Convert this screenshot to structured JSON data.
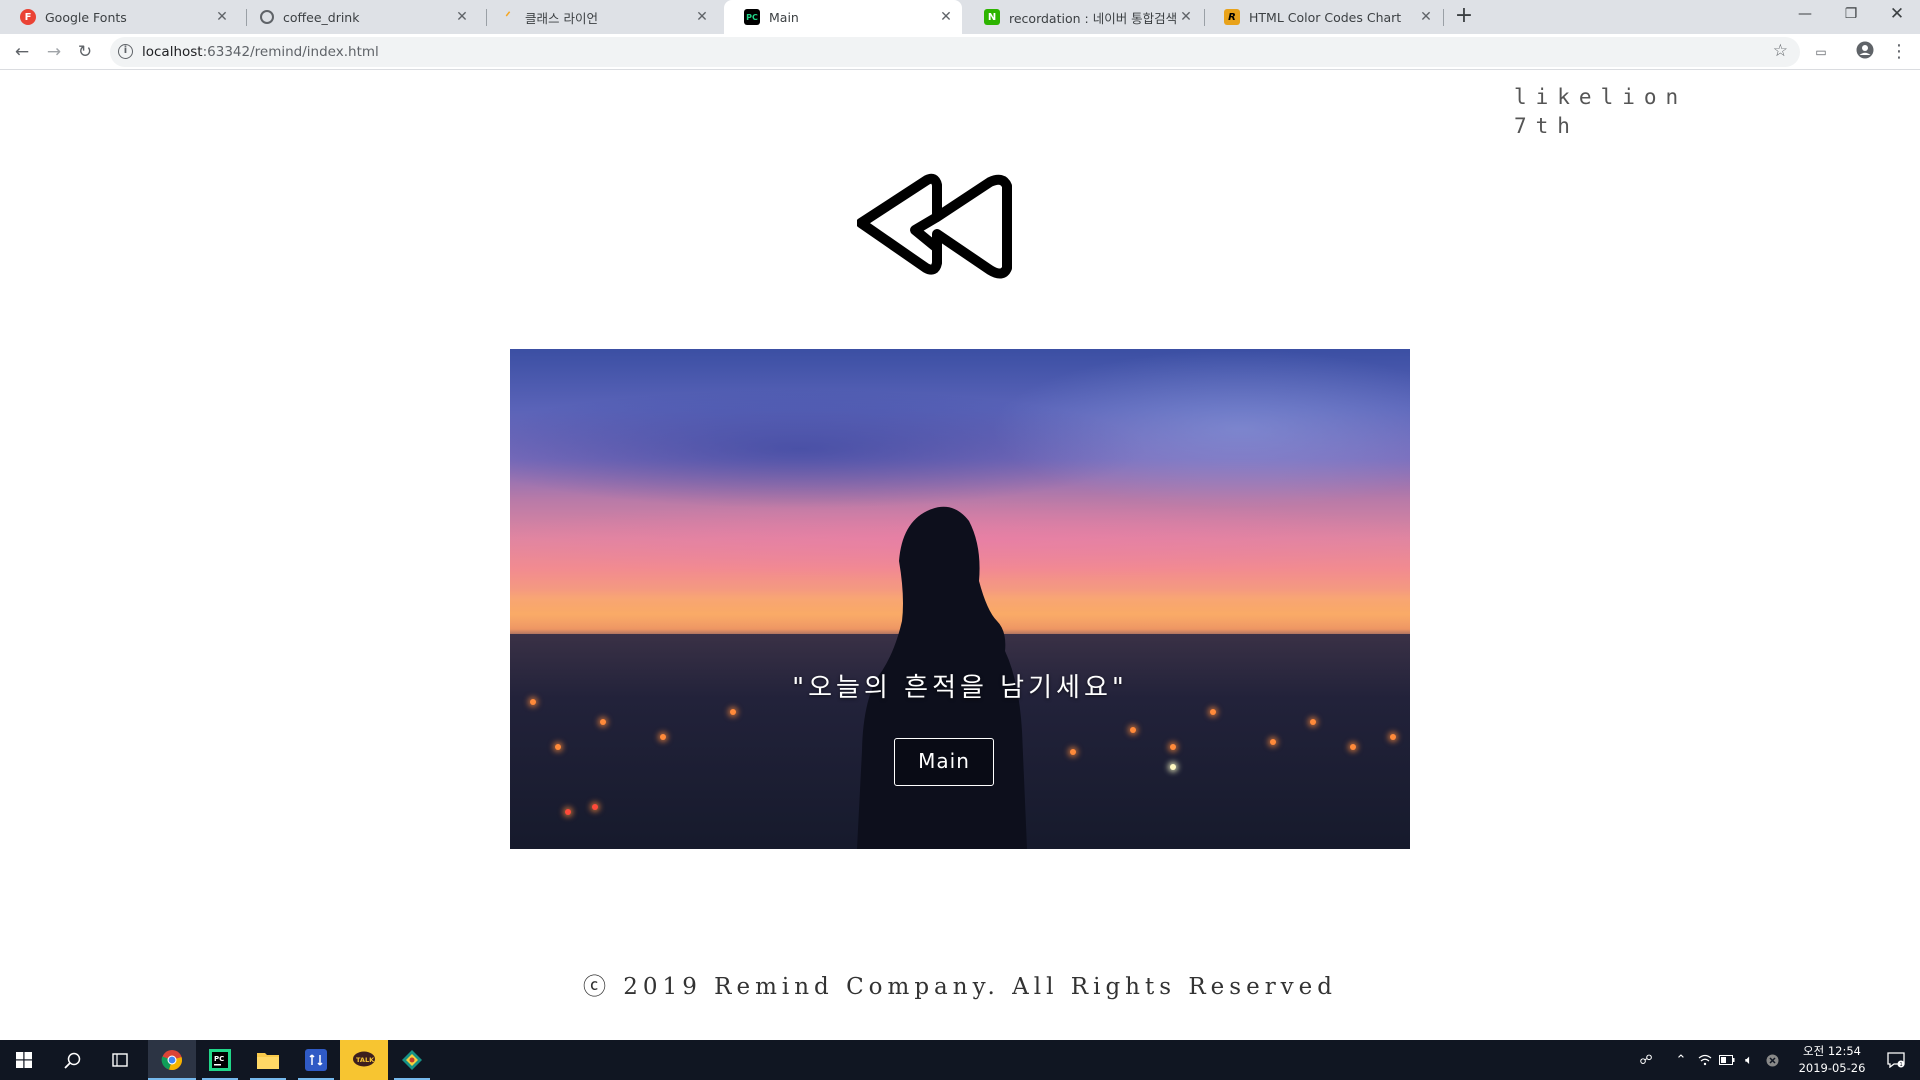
{
  "browser": {
    "tabs": [
      {
        "title": "Google Fonts",
        "favicon_letter": "F",
        "favicon_color": "#ea4335",
        "active": false
      },
      {
        "title": "coffee_drink",
        "favicon_letter": "",
        "favicon_color": "#5f6368",
        "active": false
      },
      {
        "title": "클래스 라이언",
        "favicon_letter": "",
        "favicon_color": "#f5a623",
        "active": false
      },
      {
        "title": "Main",
        "favicon_letter": "PC",
        "favicon_color": "#000000",
        "active": true
      },
      {
        "title": "recordation : 네이버 통합검색",
        "favicon_letter": "N",
        "favicon_color": "#2db400",
        "active": false
      },
      {
        "title": "HTML Color Codes Chart",
        "favicon_letter": "R",
        "favicon_color": "#e8a21a",
        "active": false
      }
    ],
    "url_host": "localhost",
    "url_rest": ":63342/remind/index.html"
  },
  "page": {
    "brand_line1": "likelion",
    "brand_line2": "7th",
    "logo_icon": "rewind-icon",
    "hero_quote": "\"오늘의 흔적을 남기세요\"",
    "hero_button": "Main",
    "footer": "ⓒ 2019 Remind Company. All Rights Reserved"
  },
  "taskbar": {
    "apps": [
      "windows-start",
      "search",
      "task-view",
      "chrome",
      "pycharm",
      "file-explorer",
      "sourcetree",
      "kakaotalk",
      "git-kraken"
    ],
    "clock_time": "오전 12:54",
    "clock_date": "2019-05-26"
  },
  "colors": {
    "tabstrip": "#dee1e6",
    "taskbar": "#101622",
    "accent": "#76b9ed"
  }
}
